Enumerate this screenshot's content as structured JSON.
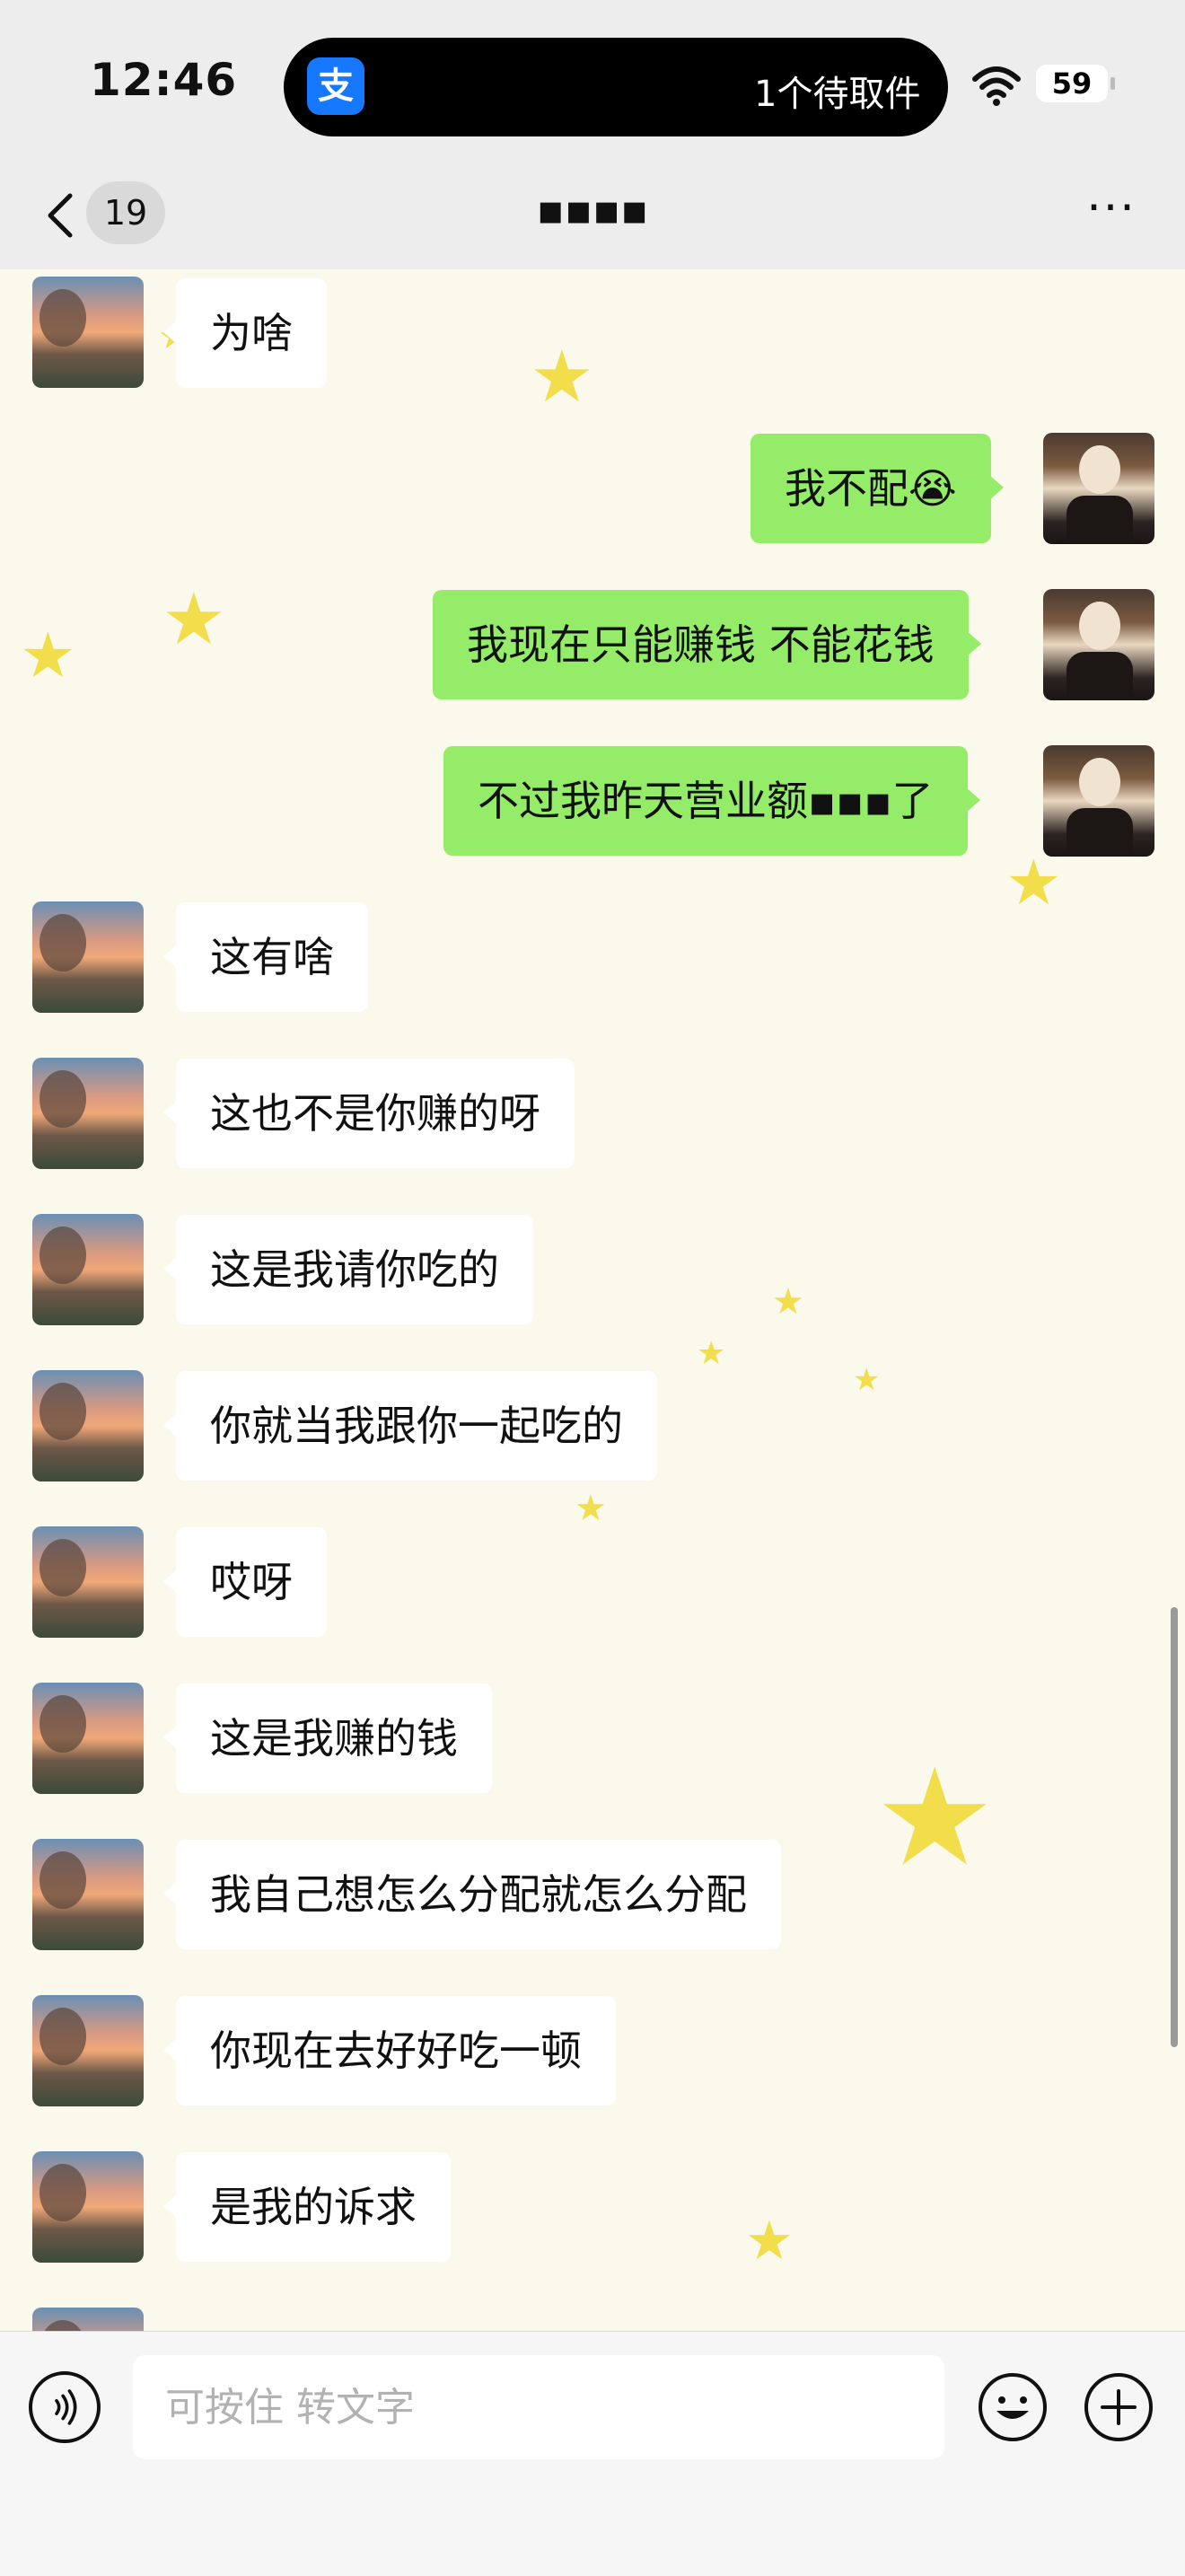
{
  "status_bar": {
    "time": "12:46",
    "app_icon_glyph": "支",
    "pickup_text": "1个待取件",
    "battery": "59"
  },
  "nav": {
    "unread_count": "19",
    "title": "▪︎▪︎▪︎▪︎"
  },
  "messages": [
    {
      "side": "left",
      "text": "为啥"
    },
    {
      "side": "right",
      "text": "我不配",
      "emoji": "😭"
    },
    {
      "side": "right",
      "text": "我现在只能赚钱 不能花钱"
    },
    {
      "side": "right",
      "text": "不过我昨天营业额▪︎▪︎▪︎了"
    },
    {
      "side": "left",
      "text": "这有啥"
    },
    {
      "side": "left",
      "text": "这也不是你赚的呀"
    },
    {
      "side": "left",
      "text": "这是我请你吃的"
    },
    {
      "side": "left",
      "text": "你就当我跟你一起吃的"
    },
    {
      "side": "left",
      "text": "哎呀"
    },
    {
      "side": "left",
      "text": "这是我赚的钱"
    },
    {
      "side": "left",
      "text": "我自己想怎么分配就怎么分配"
    },
    {
      "side": "left",
      "text": "你现在去好好吃一顿"
    },
    {
      "side": "left",
      "text": "是我的诉求"
    }
  ],
  "input": {
    "placeholder": "可按住 转文字"
  },
  "colors": {
    "bubble_mine": "#95ec69",
    "bubble_theirs": "#ffffff",
    "star": "#f2dd4a",
    "background": "#fbf8ec"
  },
  "icons": [
    "wifi-icon",
    "back-icon",
    "more-icon",
    "voice-icon",
    "emoji-icon",
    "plus-icon",
    "alipay-icon"
  ]
}
